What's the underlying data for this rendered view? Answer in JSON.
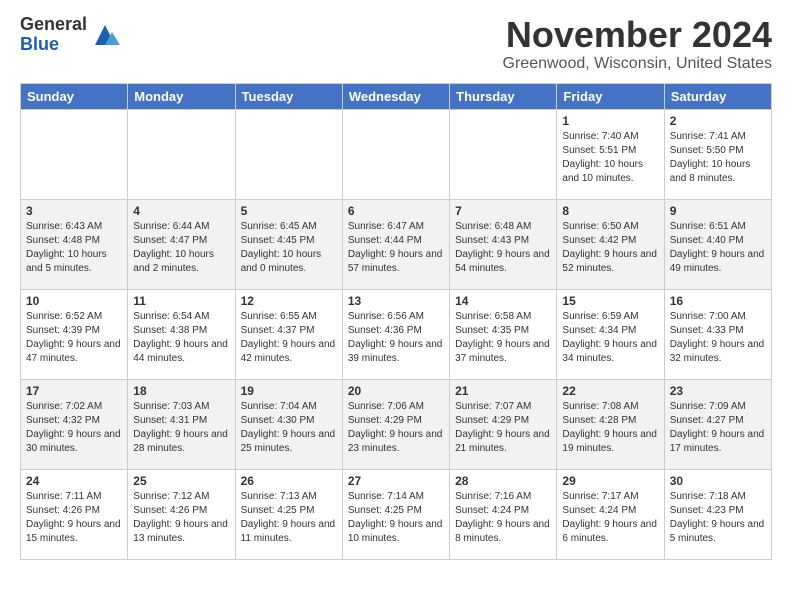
{
  "header": {
    "logo_line1": "General",
    "logo_line2": "Blue",
    "month": "November 2024",
    "location": "Greenwood, Wisconsin, United States"
  },
  "days_of_week": [
    "Sunday",
    "Monday",
    "Tuesday",
    "Wednesday",
    "Thursday",
    "Friday",
    "Saturday"
  ],
  "weeks": [
    [
      {
        "day": "",
        "info": ""
      },
      {
        "day": "",
        "info": ""
      },
      {
        "day": "",
        "info": ""
      },
      {
        "day": "",
        "info": ""
      },
      {
        "day": "",
        "info": ""
      },
      {
        "day": "1",
        "info": "Sunrise: 7:40 AM\nSunset: 5:51 PM\nDaylight: 10 hours and 10 minutes."
      },
      {
        "day": "2",
        "info": "Sunrise: 7:41 AM\nSunset: 5:50 PM\nDaylight: 10 hours and 8 minutes."
      }
    ],
    [
      {
        "day": "3",
        "info": "Sunrise: 6:43 AM\nSunset: 4:48 PM\nDaylight: 10 hours and 5 minutes."
      },
      {
        "day": "4",
        "info": "Sunrise: 6:44 AM\nSunset: 4:47 PM\nDaylight: 10 hours and 2 minutes."
      },
      {
        "day": "5",
        "info": "Sunrise: 6:45 AM\nSunset: 4:45 PM\nDaylight: 10 hours and 0 minutes."
      },
      {
        "day": "6",
        "info": "Sunrise: 6:47 AM\nSunset: 4:44 PM\nDaylight: 9 hours and 57 minutes."
      },
      {
        "day": "7",
        "info": "Sunrise: 6:48 AM\nSunset: 4:43 PM\nDaylight: 9 hours and 54 minutes."
      },
      {
        "day": "8",
        "info": "Sunrise: 6:50 AM\nSunset: 4:42 PM\nDaylight: 9 hours and 52 minutes."
      },
      {
        "day": "9",
        "info": "Sunrise: 6:51 AM\nSunset: 4:40 PM\nDaylight: 9 hours and 49 minutes."
      }
    ],
    [
      {
        "day": "10",
        "info": "Sunrise: 6:52 AM\nSunset: 4:39 PM\nDaylight: 9 hours and 47 minutes."
      },
      {
        "day": "11",
        "info": "Sunrise: 6:54 AM\nSunset: 4:38 PM\nDaylight: 9 hours and 44 minutes."
      },
      {
        "day": "12",
        "info": "Sunrise: 6:55 AM\nSunset: 4:37 PM\nDaylight: 9 hours and 42 minutes."
      },
      {
        "day": "13",
        "info": "Sunrise: 6:56 AM\nSunset: 4:36 PM\nDaylight: 9 hours and 39 minutes."
      },
      {
        "day": "14",
        "info": "Sunrise: 6:58 AM\nSunset: 4:35 PM\nDaylight: 9 hours and 37 minutes."
      },
      {
        "day": "15",
        "info": "Sunrise: 6:59 AM\nSunset: 4:34 PM\nDaylight: 9 hours and 34 minutes."
      },
      {
        "day": "16",
        "info": "Sunrise: 7:00 AM\nSunset: 4:33 PM\nDaylight: 9 hours and 32 minutes."
      }
    ],
    [
      {
        "day": "17",
        "info": "Sunrise: 7:02 AM\nSunset: 4:32 PM\nDaylight: 9 hours and 30 minutes."
      },
      {
        "day": "18",
        "info": "Sunrise: 7:03 AM\nSunset: 4:31 PM\nDaylight: 9 hours and 28 minutes."
      },
      {
        "day": "19",
        "info": "Sunrise: 7:04 AM\nSunset: 4:30 PM\nDaylight: 9 hours and 25 minutes."
      },
      {
        "day": "20",
        "info": "Sunrise: 7:06 AM\nSunset: 4:29 PM\nDaylight: 9 hours and 23 minutes."
      },
      {
        "day": "21",
        "info": "Sunrise: 7:07 AM\nSunset: 4:29 PM\nDaylight: 9 hours and 21 minutes."
      },
      {
        "day": "22",
        "info": "Sunrise: 7:08 AM\nSunset: 4:28 PM\nDaylight: 9 hours and 19 minutes."
      },
      {
        "day": "23",
        "info": "Sunrise: 7:09 AM\nSunset: 4:27 PM\nDaylight: 9 hours and 17 minutes."
      }
    ],
    [
      {
        "day": "24",
        "info": "Sunrise: 7:11 AM\nSunset: 4:26 PM\nDaylight: 9 hours and 15 minutes."
      },
      {
        "day": "25",
        "info": "Sunrise: 7:12 AM\nSunset: 4:26 PM\nDaylight: 9 hours and 13 minutes."
      },
      {
        "day": "26",
        "info": "Sunrise: 7:13 AM\nSunset: 4:25 PM\nDaylight: 9 hours and 11 minutes."
      },
      {
        "day": "27",
        "info": "Sunrise: 7:14 AM\nSunset: 4:25 PM\nDaylight: 9 hours and 10 minutes."
      },
      {
        "day": "28",
        "info": "Sunrise: 7:16 AM\nSunset: 4:24 PM\nDaylight: 9 hours and 8 minutes."
      },
      {
        "day": "29",
        "info": "Sunrise: 7:17 AM\nSunset: 4:24 PM\nDaylight: 9 hours and 6 minutes."
      },
      {
        "day": "30",
        "info": "Sunrise: 7:18 AM\nSunset: 4:23 PM\nDaylight: 9 hours and 5 minutes."
      }
    ]
  ]
}
